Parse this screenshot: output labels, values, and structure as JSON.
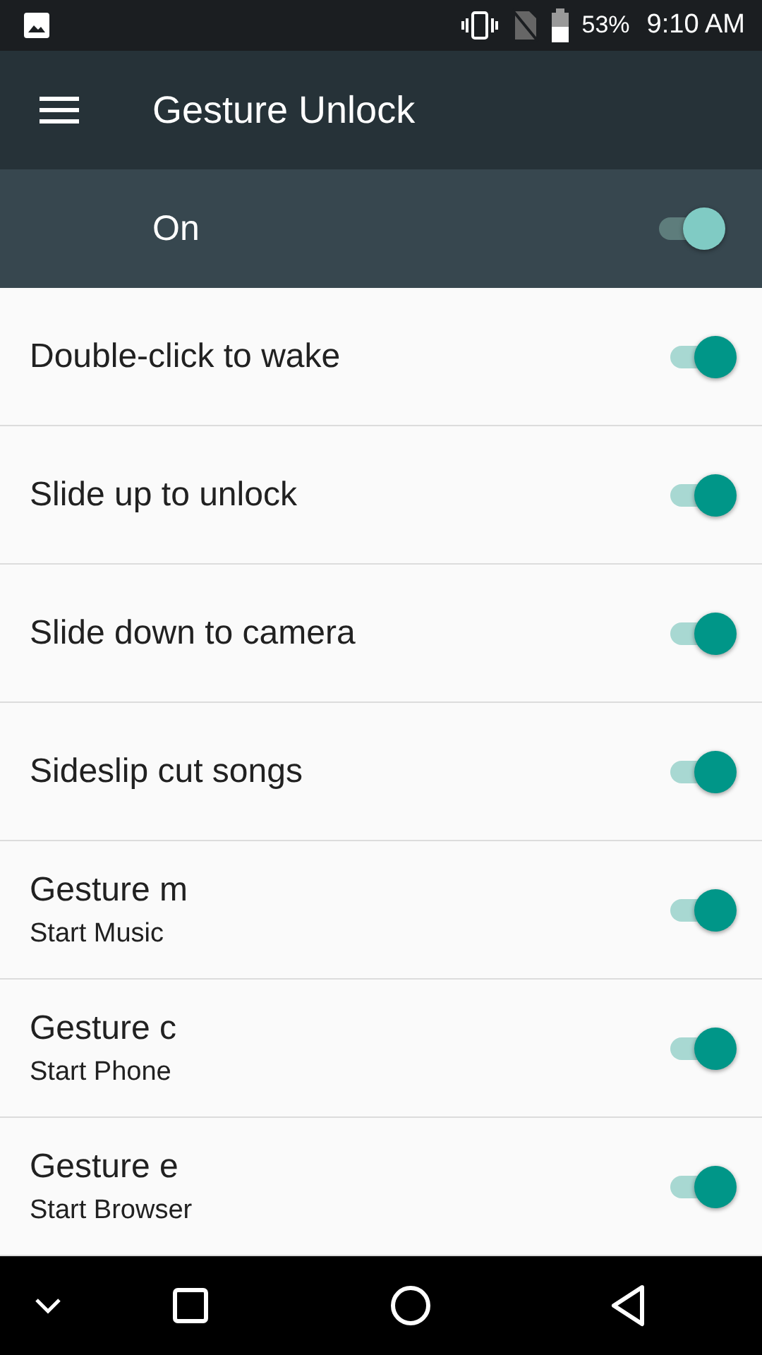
{
  "status_bar": {
    "battery": "53%",
    "time": "9:10 AM"
  },
  "app_bar": {
    "title": "Gesture Unlock"
  },
  "master_switch": {
    "label": "On",
    "on": true
  },
  "settings": [
    {
      "title": "Double-click to wake",
      "on": true
    },
    {
      "title": "Slide up to unlock",
      "on": true
    },
    {
      "title": "Slide down to camera",
      "on": true
    },
    {
      "title": "Sideslip cut songs",
      "on": true
    },
    {
      "title": "Gesture m",
      "subtitle": "Start Music",
      "on": true
    },
    {
      "title": "Gesture c",
      "subtitle": "Start Phone",
      "on": true
    },
    {
      "title": "Gesture e",
      "subtitle": "Start Browser",
      "on": true
    }
  ]
}
